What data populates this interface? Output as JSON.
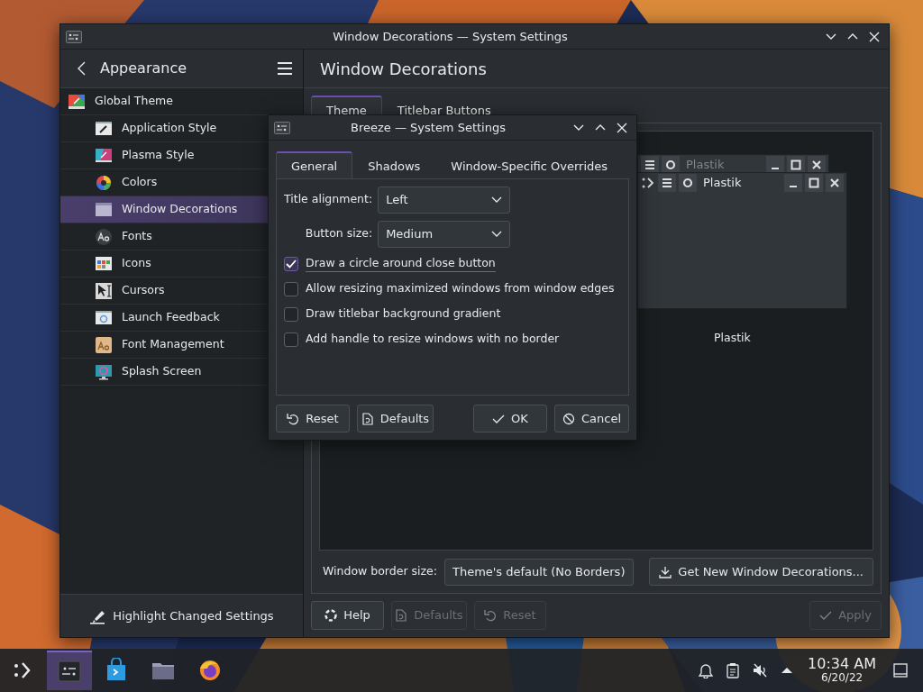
{
  "main_window": {
    "title": "Window Decorations — System Settings"
  },
  "sidebar": {
    "header": "Appearance",
    "items": [
      {
        "label": "Global Theme",
        "kind": "theme",
        "selected": false,
        "children": [
          {
            "label": "Application Style",
            "kind": "brush",
            "selected": false
          },
          {
            "label": "Plasma Style",
            "kind": "plasma",
            "selected": false
          },
          {
            "label": "Colors",
            "kind": "colors",
            "selected": false
          },
          {
            "label": "Window Decorations",
            "kind": "window",
            "selected": true
          },
          {
            "label": "Fonts",
            "kind": "fonts",
            "selected": false
          },
          {
            "label": "Icons",
            "kind": "icons",
            "selected": false
          },
          {
            "label": "Cursors",
            "kind": "cursors",
            "selected": false
          },
          {
            "label": "Launch Feedback",
            "kind": "feedback",
            "selected": false
          },
          {
            "label": "Font Management",
            "kind": "fontmgmt",
            "selected": false
          },
          {
            "label": "Splash Screen",
            "kind": "splash",
            "selected": false
          }
        ]
      }
    ],
    "footer_button": "Highlight Changed Settings"
  },
  "page": {
    "title": "Window Decorations",
    "tabs": [
      {
        "label": "Theme",
        "selected": true
      },
      {
        "label": "Titlebar Buttons",
        "selected": false
      }
    ],
    "previews": [
      {
        "title": "Plastik",
        "active": false
      },
      {
        "title": "Plastik",
        "active": true
      }
    ],
    "preview_caption": "Plastik",
    "border_size_label": "Window border size:",
    "border_size_value": "Theme's default (No Borders)",
    "get_new_button": "Get New Window Decorations...",
    "buttons": [
      {
        "label": "Help",
        "kind": "help",
        "disabled": false
      },
      {
        "label": "Defaults",
        "kind": "defaults",
        "disabled": true
      },
      {
        "label": "Reset",
        "kind": "reset",
        "disabled": true
      },
      {
        "label": "Apply",
        "kind": "apply",
        "disabled": true
      }
    ]
  },
  "dialog": {
    "title": "Breeze — System Settings",
    "tabs": [
      {
        "label": "General",
        "selected": true
      },
      {
        "label": "Shadows",
        "selected": false
      },
      {
        "label": "Window-Specific Overrides",
        "selected": false
      }
    ],
    "fields": [
      {
        "label": "Title alignment:",
        "value": "Left"
      },
      {
        "label": "Button size:",
        "value": "Medium"
      }
    ],
    "checkboxes": [
      {
        "label": "Draw a circle around close button",
        "checked": true,
        "focused": true
      },
      {
        "label": "Allow resizing maximized windows from window edges",
        "checked": false,
        "focused": false
      },
      {
        "label": "Draw titlebar background gradient",
        "checked": false,
        "focused": false
      },
      {
        "label": "Add handle to resize windows with no border",
        "checked": false,
        "focused": false
      }
    ],
    "buttons": [
      {
        "label": "Reset",
        "kind": "reset"
      },
      {
        "label": "Defaults",
        "kind": "defaults"
      },
      {
        "label": "OK",
        "kind": "ok"
      },
      {
        "label": "Cancel",
        "kind": "cancel"
      }
    ]
  },
  "taskbar": {
    "tasks": [
      {
        "kind": "settings",
        "selected": true
      },
      {
        "kind": "store",
        "selected": false
      },
      {
        "kind": "files",
        "selected": false
      },
      {
        "kind": "browser",
        "selected": false
      }
    ],
    "clock_time": "10:34 AM",
    "clock_date": "6/20/22"
  }
}
